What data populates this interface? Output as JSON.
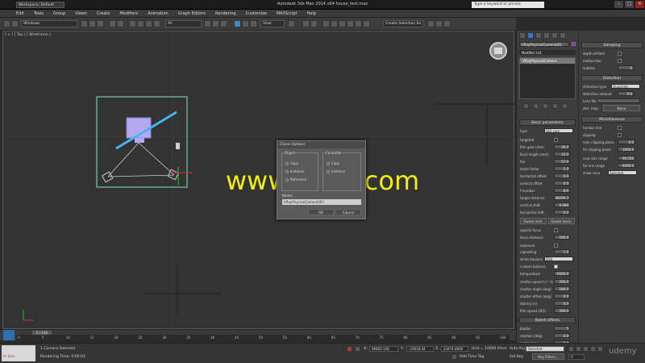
{
  "window": {
    "title": "Autodesk 3ds Max 2014 x64    house_test.max",
    "workspace": "Workspace: Default",
    "search_placeholder": "Type a keyword or phrase"
  },
  "menu": [
    "Edit",
    "Tools",
    "Group",
    "Views",
    "Create",
    "Modifiers",
    "Animation",
    "Graph Editors",
    "Rendering",
    "Customize",
    "MAXScript",
    "Help"
  ],
  "toolbar": {
    "layer": "Windows",
    "filter": "All",
    "coord": "View",
    "named_sel": "Create Selection Se"
  },
  "viewport": {
    "label": "[ + ] [ Top ] [ Wireframe ]"
  },
  "command_panel": {
    "object_name": "VRayPhysicalCamera002",
    "modifier_list": "Modifier List",
    "stack_item": "VRayPhysicalCamera",
    "basic_header": "Basic parameters",
    "params": [
      {
        "label": "type",
        "value": "Still cam"
      },
      {
        "label": "targeted",
        "value": ""
      },
      {
        "label": "film gate (mm)",
        "value": "36.0"
      },
      {
        "label": "focal length (mm)",
        "value": "33.0"
      },
      {
        "label": "fov",
        "value": "57.0"
      },
      {
        "label": "zoom factor",
        "value": "1.0"
      },
      {
        "label": "horizontal offset",
        "value": "0.0"
      },
      {
        "label": "vertical offset",
        "value": "0.0"
      },
      {
        "label": "f-number",
        "value": "8.0"
      },
      {
        "label": "target distance",
        "value": "48299.3"
      },
      {
        "label": "vertical shift",
        "value": "0.098"
      },
      {
        "label": "horizontal shift",
        "value": "0.0"
      }
    ],
    "guess_vert": "Guess vert.",
    "guess_horiz": "Guess horiz.",
    "params2": [
      {
        "label": "specify focus",
        "value": ""
      },
      {
        "label": "focus distance",
        "value": "200.0"
      },
      {
        "label": "exposure",
        "value": ""
      },
      {
        "label": "vignetting",
        "value": "1.0"
      },
      {
        "label": "white balance",
        "value": "D50"
      },
      {
        "label": "custom balance",
        "value": ""
      },
      {
        "label": "temperature",
        "value": "6500.0"
      },
      {
        "label": "shutter speed (s^-1)",
        "value": "200.0"
      },
      {
        "label": "shutter angle (deg)",
        "value": "180.0"
      },
      {
        "label": "shutter offset (deg)",
        "value": "0.0"
      },
      {
        "label": "latency (s)",
        "value": "0.0"
      },
      {
        "label": "film speed (ISO)",
        "value": "200.0"
      }
    ],
    "bokeh_header": "Bokeh effects",
    "bokeh": [
      {
        "label": "blades",
        "value": "5"
      },
      {
        "label": "rotation (deg)",
        "value": "0.0"
      },
      {
        "label": "center bias",
        "value": "0.0"
      },
      {
        "label": "anisotropy",
        "value": "0.0"
      }
    ]
  },
  "side_panel": {
    "sampling_header": "Sampling",
    "sampling": [
      {
        "label": "depth-of-field",
        "value": ""
      },
      {
        "label": "motion blur",
        "value": ""
      },
      {
        "label": "subdivs",
        "value": "6"
      }
    ],
    "distortion_header": "Distortion",
    "distortion": [
      {
        "label": "distortion type",
        "value": "Quadratic"
      },
      {
        "label": "distortion amount",
        "value": "0.0"
      },
      {
        "label": "Lens file",
        "value": ""
      }
    ],
    "dist_map": "dist. map",
    "dist_map_value": "None",
    "misc_header": "Miscellaneous",
    "misc": [
      {
        "label": "horizon line",
        "value": ""
      },
      {
        "label": "clipping",
        "value": ""
      },
      {
        "label": "near clipping plane",
        "value": "0.0"
      },
      {
        "label": "far clipping plane",
        "value": "1000.0"
      },
      {
        "label": "near env range",
        "value": "90,556"
      },
      {
        "label": "far env range",
        "value": "9300.0"
      },
      {
        "label": "show cone",
        "value": "Selected"
      }
    ]
  },
  "dialog": {
    "title": "Clone Options",
    "object_group": "Object",
    "options": [
      "Copy",
      "Instance",
      "Reference"
    ],
    "controller_group": "Controller",
    "controller_options": [
      "Copy",
      "Instance"
    ],
    "name_label": "Name:",
    "name_value": "VRayPhysicalCamera003",
    "ok": "OK",
    "cancel": "Cancel"
  },
  "watermark": "www.cgtsj.com",
  "timeline": {
    "frame": "0 / 100",
    "ticks": [
      "0",
      "5",
      "10",
      "15",
      "20",
      "25",
      "30",
      "35",
      "40",
      "45",
      "50",
      "55",
      "60",
      "65",
      "70",
      "75",
      "80",
      "85",
      "90",
      "95",
      "100"
    ]
  },
  "status": {
    "selection": "1 Camera Selected",
    "prompt": "Rendering Time: 0:00:03",
    "maxscript": "In line:",
    "x_label": "X:",
    "x": "46803.148",
    "y_label": "Y:",
    "y": "-23618.44",
    "z_label": "Z:",
    "z": "23474.4646",
    "grid": "Grid = 10000.0mm",
    "add_time_tag": "Add Time Tag",
    "auto_key": "Auto Key",
    "selected": "Selected",
    "set_key": "Set Key",
    "key_filters": "Key Filters...",
    "frame_value": "0"
  },
  "logo": "udemy",
  "colors": {
    "accent": "#f1ee14",
    "selection": "#45b6f0",
    "camera": "#b4a8f0",
    "bbox": "#7fe8c8"
  }
}
